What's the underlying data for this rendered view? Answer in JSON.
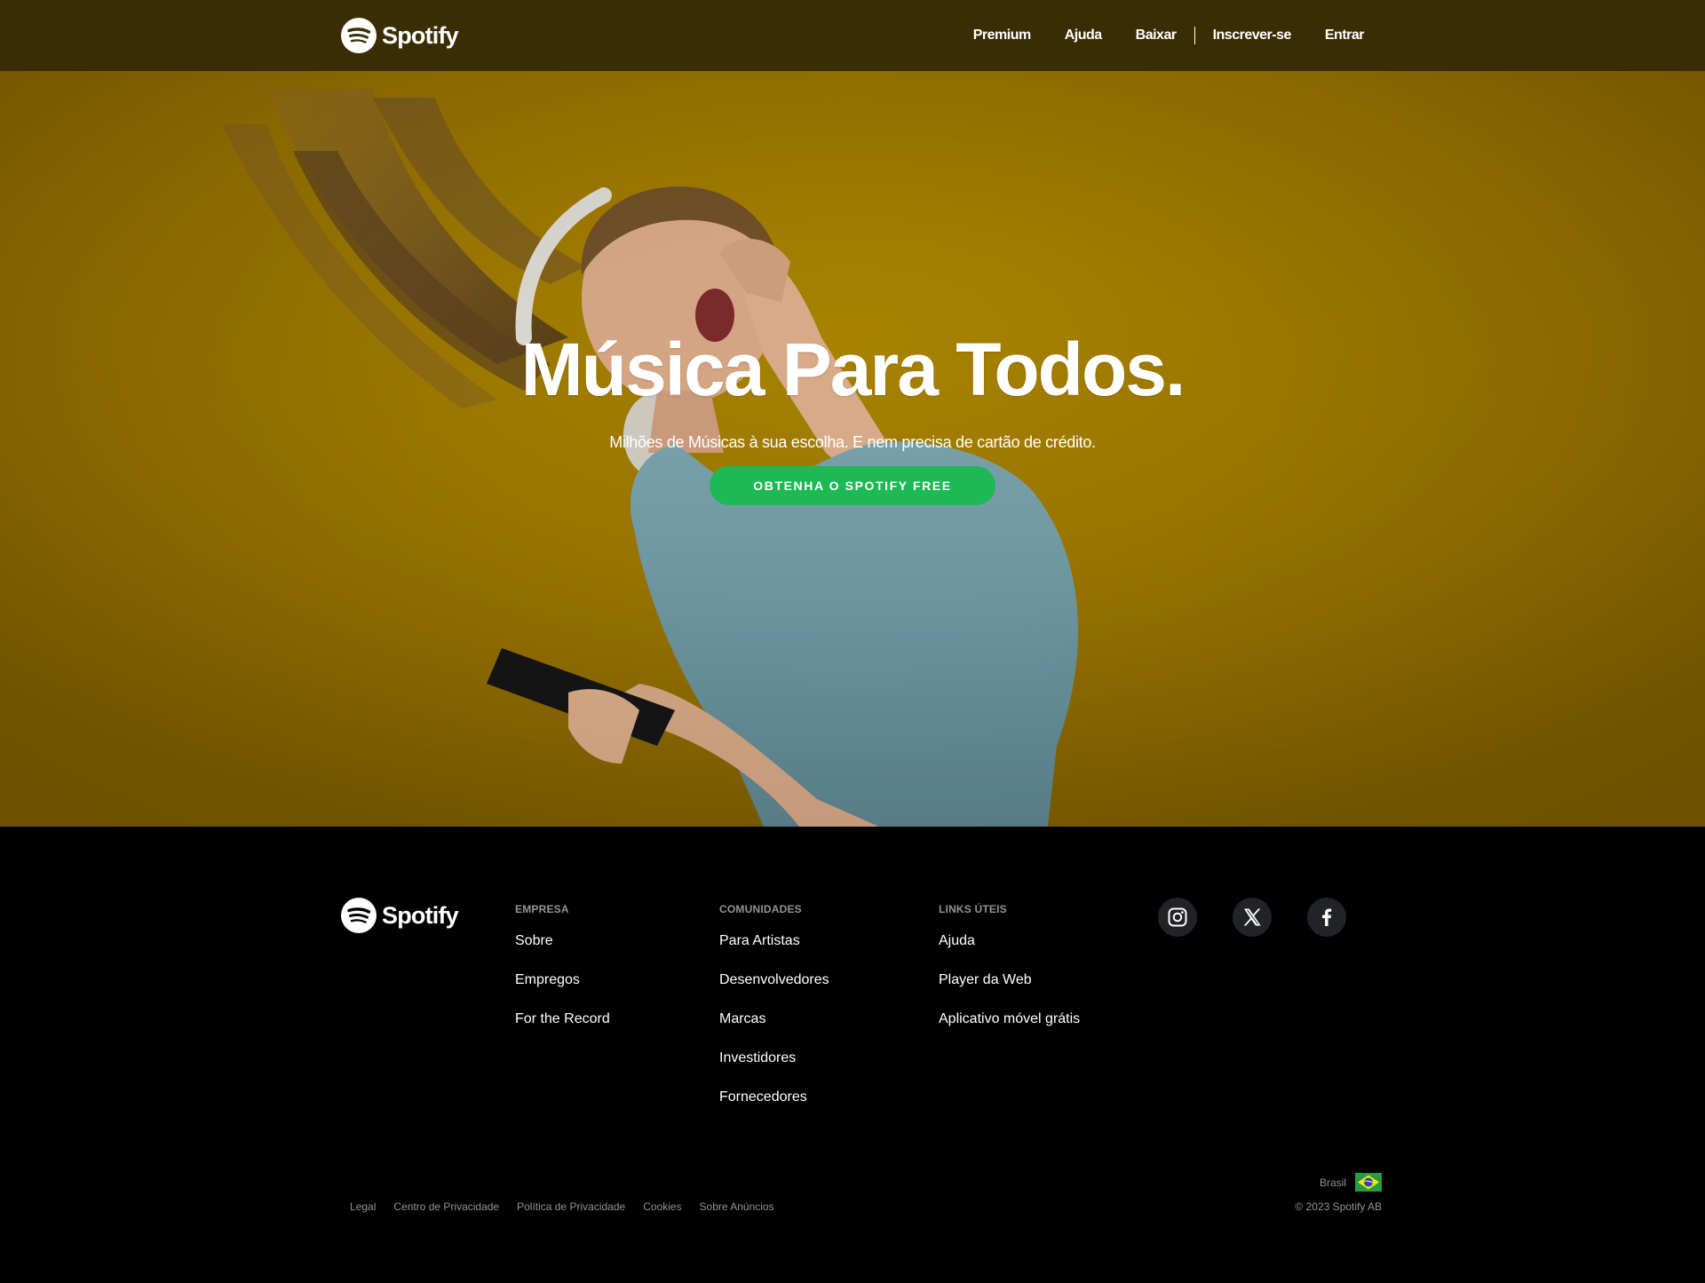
{
  "header": {
    "logo": {
      "text": "Spotify",
      "icon": "spotify-logo-icon"
    },
    "nav": [
      {
        "label": "Premium"
      },
      {
        "label": "Ajuda"
      },
      {
        "label": "Baixar"
      },
      {
        "label": "Inscrever-se"
      },
      {
        "label": "Entrar"
      }
    ]
  },
  "hero": {
    "title": "Música Para Todos.",
    "subtitle": "Milhões de Músicas à sua escolha. E nem precisa de cartão de crédito.",
    "cta_label": "OBTENHA O SPOTIFY FREE",
    "background_color": "#9a7700",
    "cta_color": "#1db954"
  },
  "footer": {
    "logo": {
      "text": "Spotify",
      "icon": "spotify-logo-icon"
    },
    "columns": [
      {
        "title": "EMPRESA",
        "links": [
          "Sobre",
          "Empregos",
          "For the Record"
        ]
      },
      {
        "title": "COMUNIDADES",
        "links": [
          "Para Artistas",
          "Desenvolvedores",
          "Marcas",
          "Investidores",
          "Fornecedores"
        ]
      },
      {
        "title": "LINKS ÚTEIS",
        "links": [
          "Ajuda",
          "Player da Web",
          "Aplicativo móvel grátis"
        ]
      }
    ],
    "social": [
      {
        "icon": "instagram-icon"
      },
      {
        "icon": "x-twitter-icon"
      },
      {
        "icon": "facebook-icon"
      }
    ],
    "legal_links": [
      "Legal",
      "Centro de Privacidade",
      "Política de Privacidade",
      "Cookies",
      "Sobre Anúncios"
    ],
    "region": "Brasil",
    "region_icon": "brazil-flag-icon",
    "copyright": "© 2023 Spotify AB"
  }
}
